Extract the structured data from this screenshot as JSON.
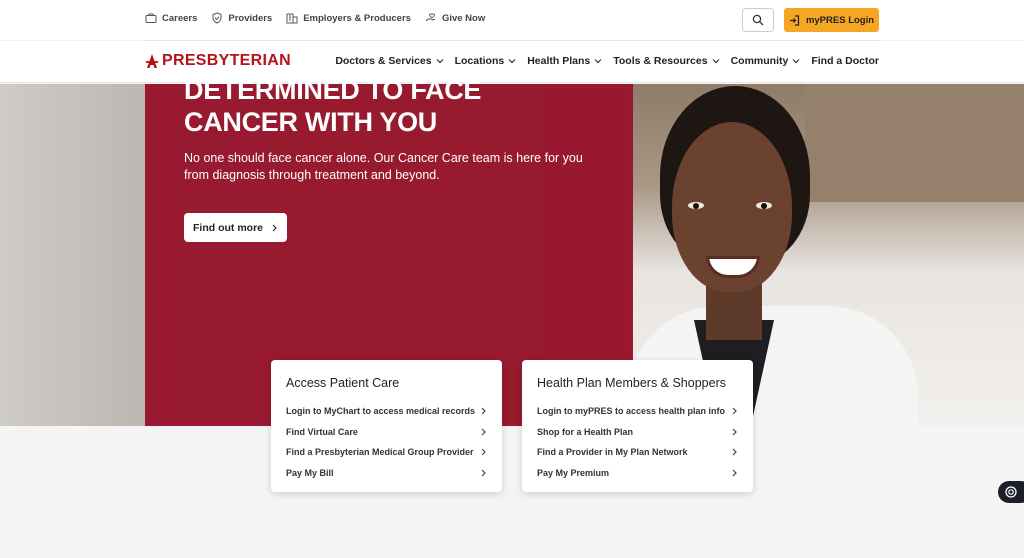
{
  "utility": {
    "links": [
      {
        "label": "Careers",
        "icon": "briefcase-icon"
      },
      {
        "label": "Providers",
        "icon": "shield-check-icon"
      },
      {
        "label": "Employers & Producers",
        "icon": "building-icon"
      },
      {
        "label": "Give Now",
        "icon": "hand-heart-icon"
      }
    ],
    "login_label": "myPRES Login"
  },
  "brand": {
    "name": "PRESBYTERIAN",
    "color": "#b5121b"
  },
  "nav": {
    "items": [
      {
        "label": "Doctors & Services",
        "dropdown": true
      },
      {
        "label": "Locations",
        "dropdown": true
      },
      {
        "label": "Health Plans",
        "dropdown": true
      },
      {
        "label": "Tools & Resources",
        "dropdown": true
      },
      {
        "label": "Community",
        "dropdown": true
      },
      {
        "label": "Find a Doctor",
        "dropdown": false
      }
    ]
  },
  "hero": {
    "title": "DETERMINED TO FACE CANCER WITH YOU",
    "text": "No one should face cancer alone. Our Cancer Care team is here for you from diagnosis through treatment and beyond.",
    "button_label": "Find out more",
    "panel_color": "#960e26"
  },
  "cards": [
    {
      "title": "Access Patient Care",
      "links": [
        "Login to MyChart to access medical records",
        "Find Virtual Care",
        "Find a Presbyterian Medical Group Provider",
        "Pay My Bill"
      ]
    },
    {
      "title": "Health Plan Members & Shoppers",
      "links": [
        "Login to myPRES to access health plan info",
        "Shop for a Health Plan",
        "Find a Provider in My Plan Network",
        "Pay My Premium"
      ]
    }
  ],
  "colors": {
    "accent": "#f5a623",
    "text": "#222222"
  }
}
